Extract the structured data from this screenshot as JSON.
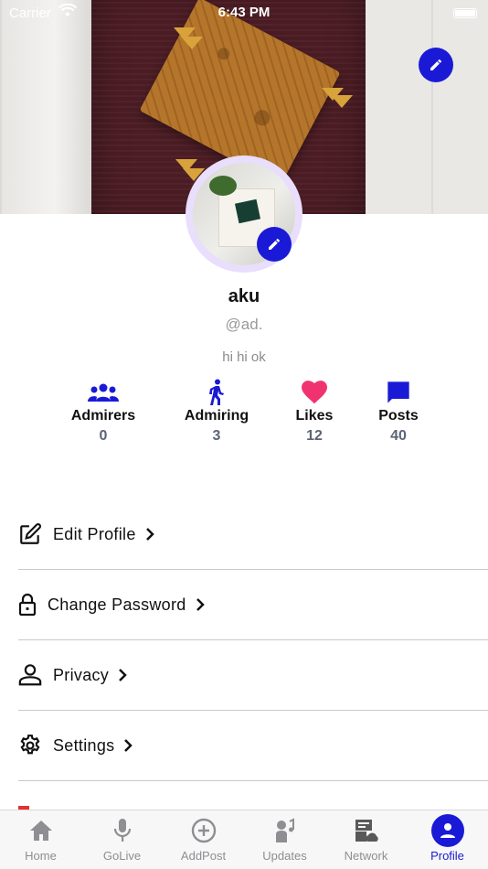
{
  "status_bar": {
    "carrier": "Carrier",
    "time": "6:43 PM"
  },
  "profile": {
    "name": "aku",
    "handle": "@ad.",
    "bio": "hi hi ok"
  },
  "stats": [
    {
      "label": "Admirers",
      "count": "0",
      "icon": "group-icon",
      "color": "#1a1ad6"
    },
    {
      "label": "Admiring",
      "count": "3",
      "icon": "walking-person-icon",
      "color": "#1a1ad6"
    },
    {
      "label": "Likes",
      "count": "12",
      "icon": "heart-icon",
      "color": "#f0336f"
    },
    {
      "label": "Posts",
      "count": "40",
      "icon": "chat-bubble-icon",
      "color": "#1a1ad6"
    }
  ],
  "menu": [
    {
      "label": "Edit Profile",
      "icon": "edit-square-icon"
    },
    {
      "label": "Change Password",
      "icon": "lock-icon"
    },
    {
      "label": "Privacy",
      "icon": "person-icon"
    },
    {
      "label": "Settings",
      "icon": "gear-icon"
    }
  ],
  "tabs": [
    {
      "label": "Home",
      "icon": "home-icon",
      "active": false
    },
    {
      "label": "GoLive",
      "icon": "microphone-icon",
      "active": false
    },
    {
      "label": "AddPost",
      "icon": "add-circle-icon",
      "active": false
    },
    {
      "label": "Updates",
      "icon": "updates-icon",
      "active": false
    },
    {
      "label": "Network",
      "icon": "network-icon",
      "active": false
    },
    {
      "label": "Profile",
      "icon": "profile-icon",
      "active": true
    }
  ],
  "colors": {
    "accent": "#1a1ad6",
    "likes": "#f0336f",
    "avatar_ring": "#e9defc"
  }
}
